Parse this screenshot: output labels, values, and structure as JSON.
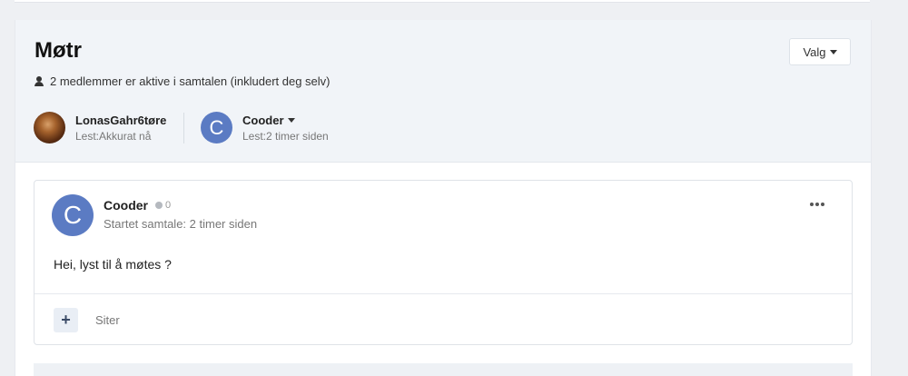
{
  "header": {
    "title": "Møtr",
    "options_label": "Valg",
    "members_text": "2 medlemmer er aktive i samtalen (inkludert deg selv)"
  },
  "participants": [
    {
      "name": "LonasGahr6tøre",
      "status": "Lest:Akkurat nå",
      "avatar": "photo"
    },
    {
      "name": "Cooder",
      "status": "Lest:2 timer siden",
      "avatar_letter": "C"
    }
  ],
  "post": {
    "author": "Cooder",
    "avatar_letter": "C",
    "reputation": "0",
    "started": "Startet samtale: 2 timer siden",
    "message": "Hei, lyst til å møtes ?",
    "quote_label": "Siter",
    "plus_label": "+"
  },
  "icons": [
    "user-icon",
    "caret-down-icon",
    "more-icon",
    "reputation-icon"
  ],
  "colors": {
    "avatar_bg": "#5b7bc3",
    "header_bg": "#f1f4f8",
    "page_bg": "#eef0f3"
  }
}
